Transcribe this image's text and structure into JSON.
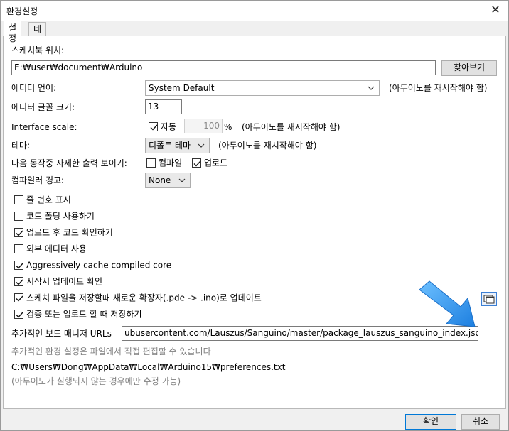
{
  "window": {
    "title": "환경설정"
  },
  "tabs": [
    {
      "label": "설정"
    },
    {
      "label": "네트워크"
    }
  ],
  "sketchbook": {
    "label": "스케치북 위치:",
    "value": "E:₩user₩document₩Arduino",
    "browse_label": "찾아보기"
  },
  "editor_language": {
    "label": "에디터 언어:",
    "value": "System Default",
    "note": "(아두이노를 재시작해야 함)"
  },
  "font_size": {
    "label": "에디터 글꼴 크기:",
    "value": "13"
  },
  "interface_scale": {
    "label": "Interface scale:",
    "auto_label": "자동",
    "value": "100",
    "unit": "%",
    "note": "(아두이노를 재시작해야 함)"
  },
  "theme": {
    "label": "테마:",
    "value": "디폴트 테마",
    "note": "(아두이노를 재시작해야 함)"
  },
  "verbose": {
    "label": "다음 동작중 자세한  출력 보이기:",
    "compile_label": "컴파일",
    "upload_label": "업로드"
  },
  "compiler_warnings": {
    "label": "컴파일러 경고:",
    "value": "None"
  },
  "options": [
    {
      "label": "줄 번호 표시",
      "checked": false
    },
    {
      "label": "코드 폴딩 사용하기",
      "checked": false
    },
    {
      "label": "업로드 후 코드 확인하기",
      "checked": true
    },
    {
      "label": "외부 에디터 사용",
      "checked": false
    },
    {
      "label": "Aggressively cache compiled core",
      "checked": true
    },
    {
      "label": "시작시 업데이트 확인",
      "checked": true
    },
    {
      "label": "스케치 파일을 저장할때 새로운 확장자(.pde -> .ino)로 업데이트",
      "checked": true
    },
    {
      "label": "검증 또는 업로드 할 때 저장하기",
      "checked": true
    }
  ],
  "board_urls": {
    "label": "추가적인 보드 매니저 URLs",
    "value": "ubusercontent.com/Lauszus/Sanguino/master/package_lauszus_sanguino_index.json"
  },
  "more_prefs": {
    "text": "추가적인 환경 설정은 파일에서 직접 편집할 수 있습니다"
  },
  "prefs_path": {
    "text": "C:₩Users₩Dong₩AppData₩Local₩Arduino15₩preferences.txt"
  },
  "edit_note": {
    "text": "(아두이노가 실행되지 않는 경우에만 수정 가능)"
  },
  "footer": {
    "ok_label": "확인",
    "cancel_label": "취소"
  },
  "colors": {
    "accent": "#0078d7",
    "arrow": "#3c9be8",
    "panel": "#ffffff",
    "window": "#f0f0f0"
  }
}
